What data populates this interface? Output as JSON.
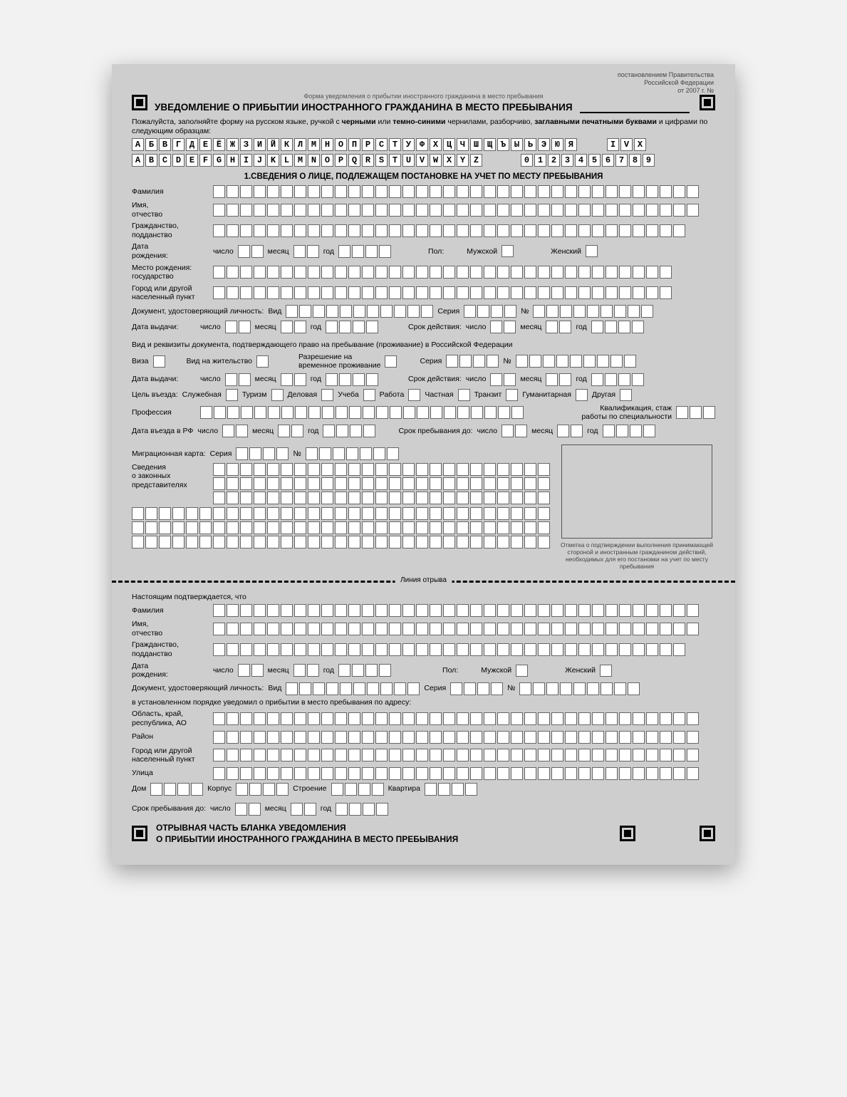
{
  "gov": {
    "l1": "постановлением Правительства",
    "l2": "Российской Федерации",
    "l3": "от                          2007 г.  №"
  },
  "form_note": "Форма уведомления о прибытии иностранного гражданина в место пребывания",
  "form_title": "УВЕДОМЛЕНИЕ О ПРИБЫТИИ ИНОСТРАННОГО ГРАЖДАНИНА В МЕСТО ПРЕБЫВАНИЯ",
  "instruction": {
    "prefix": "Пожалуйста, заполняйте форму на русском языке, ручкой с ",
    "b1": "черными",
    "mid1": " или ",
    "b2": "темно-синими",
    "mid2": " чернилами, разборчиво, ",
    "b3": "заглавными печатными буквами",
    "suffix": " и цифрами по следующим образцам:"
  },
  "sample_ru": "АБВГДЕЁЖЗИЙКЛМНОПРСТУФХЦЧШЩЪЫЬЭЮЯ",
  "sample_en": "ABCDEFGHIJKLMNOPQRSTUVWXYZ",
  "sample_ivx": "IVX",
  "sample_digits": "0123456789",
  "section1_title": "1.СВЕДЕНИЯ О ЛИЦЕ, ПОДЛЕЖАЩЕМ ПОСТАНОВКЕ НА УЧЕТ ПО МЕСТУ ПРЕБЫВАНИЯ",
  "labels": {
    "surname": "Фамилия",
    "name_patr": "Имя,\nотчество",
    "citizenship": "Гражданство,\nподданство",
    "dob_prefix": "Дата\nрождения:",
    "day": "число",
    "month": "месяц",
    "year": "год",
    "sex": "Пол:",
    "male": "Мужской",
    "female": "Женский",
    "birth_country": "Место рождения:\nгосударство",
    "city": "Город или другой\nнаселенный пункт",
    "id_doc": "Документ, удостоверяющий личность:",
    "type": "Вид",
    "series": "Серия",
    "number": "№",
    "issue_date": "Дата выдачи:",
    "validity": "Срок действия:",
    "stay_doc_h": "Вид и реквизиты документа, подтверждающего право на пребывание (проживание) в Российской Федерации",
    "visa": "Виза",
    "residence": "Вид на жительство",
    "temp_res": "Разрешение на\nвременное проживание",
    "purpose": "Цель въезда:",
    "p_service": "Служебная",
    "p_tourism": "Туризм",
    "p_business": "Деловая",
    "p_study": "Учеба",
    "p_work": "Работа",
    "p_private": "Частная",
    "p_transit": "Транзит",
    "p_human": "Гуманитарная",
    "p_other": "Другая",
    "profession": "Профессия",
    "qualification": "Квалификация, стаж\nработы по специальности",
    "entry_date": "Дата въезда в РФ",
    "stay_until": "Срок пребывания до:",
    "mig_card": "Миграционная карта:",
    "reps": "Сведения\nо законных\nпредставителях",
    "box_note": "Отметка о подтверждении выполнения принимающей стороной и иностранным гражданином действий, необходимых для его постановки на учет по месту пребывания",
    "tear": "Линия отрыва",
    "confirm": "Настоящим подтверждается, что",
    "notified": "в установленном порядке уведомил о прибытии в место пребывания по адресу:",
    "region": "Область, край,\nреспублика, АО",
    "district": "Район",
    "street": "Улица",
    "house": "Дом",
    "korpus": "Корпус",
    "building": "Строение",
    "apt": "Квартира",
    "foot1": "ОТРЫВНАЯ ЧАСТЬ БЛАНКА УВЕДОМЛЕНИЯ",
    "foot2": "О ПРИБЫТИИ ИНОСТРАННОГО ГРАЖДАНИНА В МЕСТО ПРЕБЫВАНИЯ"
  }
}
